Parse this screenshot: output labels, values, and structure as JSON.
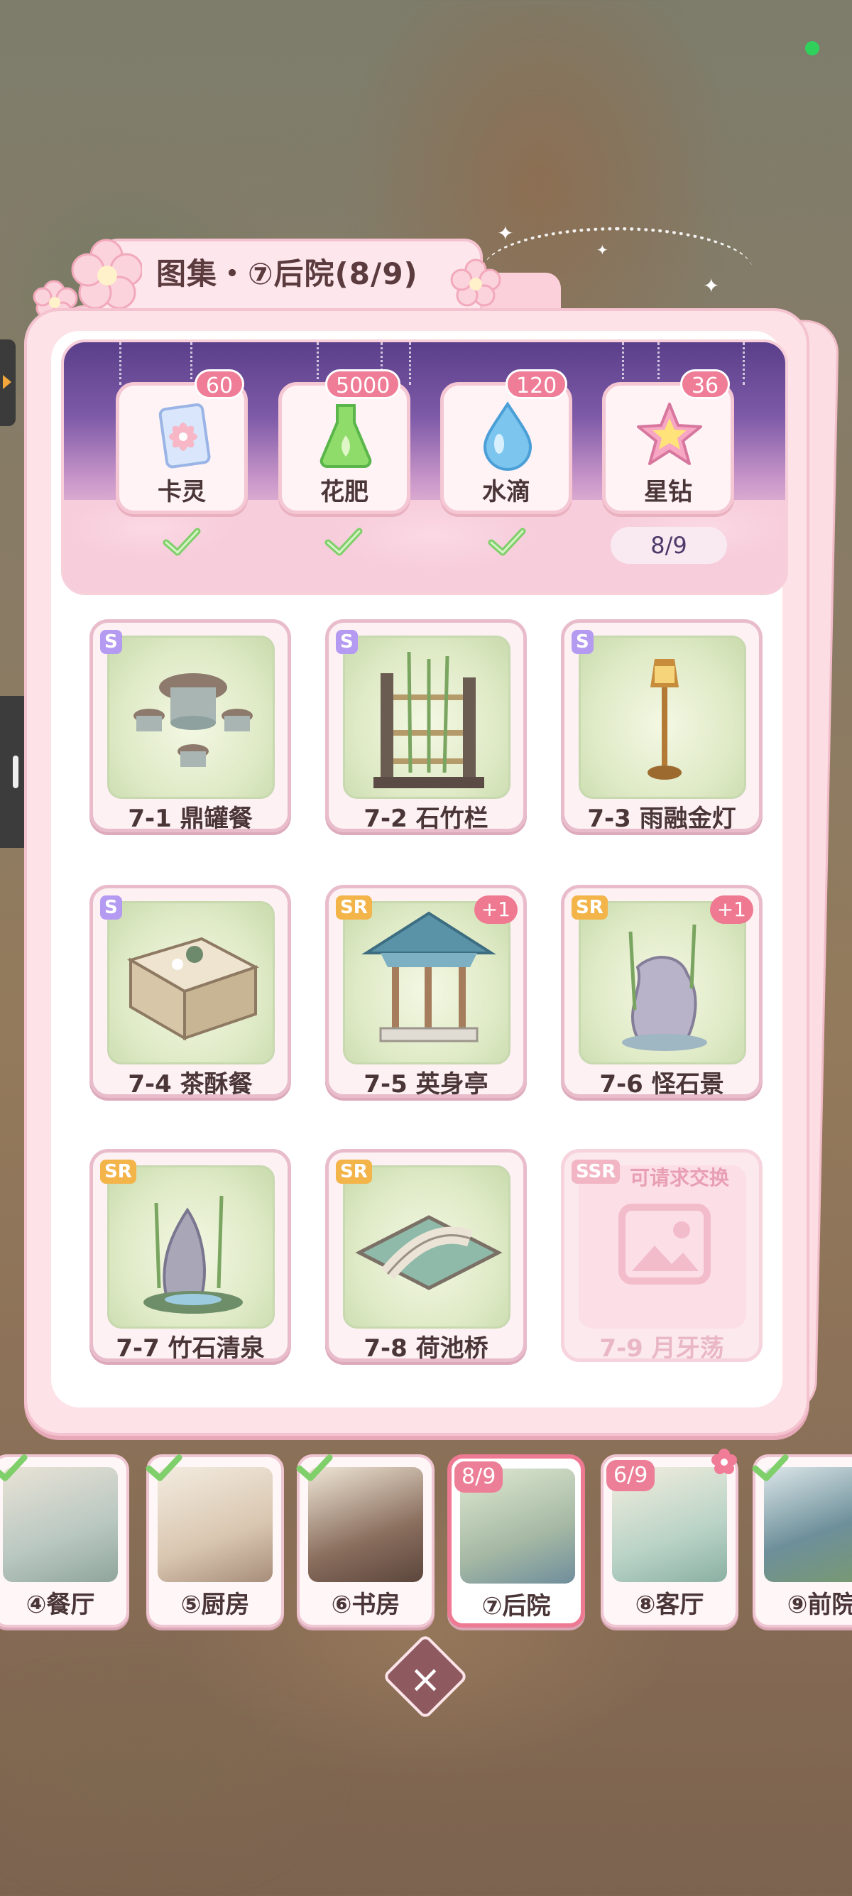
{
  "header": {
    "title": "图集・⑦后院(8/9)"
  },
  "rewards": [
    {
      "label": "卡灵",
      "count": "60",
      "icon": "card-icon",
      "claimed": true
    },
    {
      "label": "花肥",
      "count": "5000",
      "icon": "fertilizer-flask-icon",
      "claimed": true
    },
    {
      "label": "水滴",
      "count": "120",
      "icon": "water-drop-icon",
      "claimed": true
    },
    {
      "label": "星钻",
      "count": "36",
      "icon": "star-diamond-icon",
      "claimed": false,
      "progress": "8/9"
    }
  ],
  "items": [
    {
      "name": "7-1 鼎罐餐",
      "rarity": "S"
    },
    {
      "name": "7-2 石竹栏",
      "rarity": "S"
    },
    {
      "name": "7-3 雨融金灯",
      "rarity": "S"
    },
    {
      "name": "7-4 茶酥餐",
      "rarity": "S"
    },
    {
      "name": "7-5 英身亭",
      "rarity": "SR",
      "extra": "+1"
    },
    {
      "name": "7-6 怪石景",
      "rarity": "SR",
      "extra": "+1"
    },
    {
      "name": "7-7 竹石清泉",
      "rarity": "SR"
    },
    {
      "name": "7-8 荷池桥",
      "rarity": "SR"
    },
    {
      "name": "7-9 月牙荡",
      "rarity": "SSR",
      "locked": true,
      "request_text": "可请求交换"
    }
  ],
  "rooms": [
    {
      "label": "④餐厅",
      "complete": true
    },
    {
      "label": "⑤厨房",
      "complete": true
    },
    {
      "label": "⑥书房",
      "complete": true
    },
    {
      "label": "⑦后院",
      "count": "8/9",
      "active": true
    },
    {
      "label": "⑧客厅",
      "count": "6/9"
    },
    {
      "label": "⑨前院",
      "complete": true
    }
  ],
  "colors": {
    "accent": "#ee7992",
    "check": "#7fcf6a",
    "banner_top": "#5a3f8a"
  }
}
